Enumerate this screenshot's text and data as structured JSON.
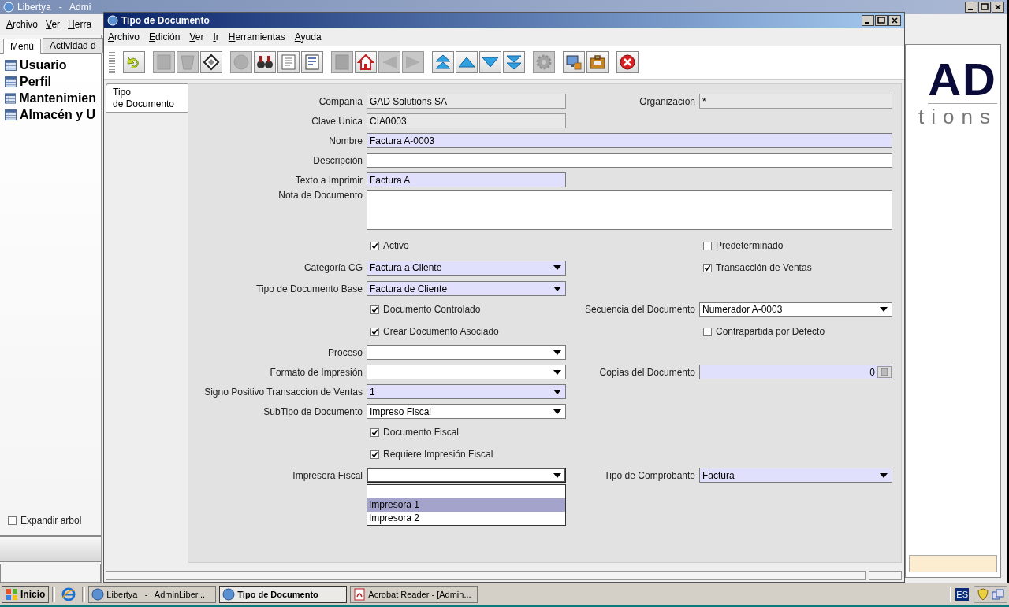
{
  "main_window": {
    "title": "Libertya   -   Admi",
    "menu": [
      "Archivo",
      "Ver",
      "Herra"
    ],
    "side_tabs": [
      {
        "label": "Menú",
        "selected": true
      },
      {
        "label": "Actividad d",
        "selected": false
      }
    ],
    "tree": [
      {
        "label": "Usuario"
      },
      {
        "label": "Perfil"
      },
      {
        "label": "Mantenimien"
      },
      {
        "label": "Almacén y U"
      }
    ],
    "expand_tree": {
      "label": "Expandir arbol",
      "checked": false
    },
    "logo": {
      "mark": "AD",
      "word": "tions"
    }
  },
  "dialog": {
    "title": "Tipo de Documento",
    "menu": [
      "Archivo",
      "Edición",
      "Ver",
      "Ir",
      "Herramientas",
      "Ayuda"
    ],
    "toolbar": [
      [
        {
          "disabled": false
        }
      ],
      [
        {
          "disabled": true
        },
        {
          "disabled": true
        },
        {
          "disabled": false
        }
      ],
      [
        {
          "disabled": true
        },
        {
          "disabled": false
        },
        {
          "disabled": false
        },
        {
          "disabled": false
        }
      ],
      [
        {
          "disabled": true
        },
        {
          "disabled": false
        },
        {
          "disabled": true
        },
        {
          "disabled": true
        }
      ],
      [
        {
          "disabled": false
        },
        {
          "disabled": false
        },
        {
          "disabled": false
        },
        {
          "disabled": false
        }
      ],
      [
        {
          "disabled": true
        }
      ],
      [
        {
          "disabled": false
        },
        {
          "disabled": false
        }
      ],
      [
        {
          "disabled": false
        }
      ]
    ],
    "tabs": [
      {
        "label": "Tipo\nde Documento",
        "selected": true
      }
    ],
    "rows": [
      {
        "left": {
          "kind": "text",
          "label": "Compañía",
          "value": "GAD Solutions SA",
          "mandatory": false,
          "readonly": true
        },
        "right": {
          "kind": "text",
          "label": "Organización",
          "value": "*",
          "mandatory": false,
          "readonly": true
        }
      },
      {
        "left": {
          "kind": "text",
          "label": "Clave Unica",
          "value": "CIA0003",
          "mandatory": false,
          "readonly": true
        }
      },
      {
        "left": {
          "kind": "wide_text",
          "label": "Nombre",
          "value": "Factura A-0003",
          "mandatory": true,
          "readonly": false
        }
      },
      {
        "left": {
          "kind": "wide_text",
          "label": "Descripción",
          "mandatory": false,
          "readonly": false
        }
      },
      {
        "left": {
          "kind": "text",
          "label": "Texto a Imprimir",
          "value": "Factura A",
          "mandatory": true,
          "readonly": false
        }
      },
      {
        "left": {
          "kind": "textarea",
          "label": "Nota de Documento",
          "mandatory": false,
          "readonly": false
        }
      },
      {
        "left": {
          "kind": "check",
          "label": "Activo",
          "checked": true
        },
        "right": {
          "kind": "check",
          "label": "Predeterminado",
          "checked": false
        }
      },
      {
        "left": {
          "kind": "combo",
          "label": "Categoría CG",
          "value": "Factura a Cliente",
          "mandatory": true,
          "open": false
        },
        "right": {
          "kind": "check",
          "label": "Transacción de Ventas",
          "checked": true
        }
      },
      {
        "left": {
          "kind": "combo",
          "label": "Tipo de Documento Base",
          "value": "Factura de Cliente",
          "mandatory": true,
          "open": false
        }
      },
      {
        "left": {
          "kind": "check",
          "label": "Documento Controlado",
          "checked": true
        },
        "right": {
          "kind": "combo",
          "label": "Secuencia del Documento",
          "value": "Numerador  A-0003",
          "mandatory": false,
          "open": false
        }
      },
      {
        "left": {
          "kind": "check",
          "label": "Crear Documento Asociado",
          "checked": true
        },
        "right": {
          "kind": "check",
          "label": "Contrapartida por Defecto",
          "checked": false
        }
      },
      {
        "left": {
          "kind": "combo",
          "label": "Proceso",
          "mandatory": false,
          "open": false
        }
      },
      {
        "left": {
          "kind": "combo",
          "label": "Formato de Impresión",
          "mandatory": false,
          "open": false
        },
        "right": {
          "kind": "number",
          "label": "Copias del Documento",
          "value": "0",
          "mandatory": true
        }
      },
      {
        "left": {
          "kind": "combo",
          "label": "Signo Positivo Transaccion de Ventas",
          "value": "1",
          "mandatory": true,
          "open": false
        }
      },
      {
        "left": {
          "kind": "combo",
          "label": "SubTipo de Documento",
          "value": "Impreso Fiscal",
          "mandatory": false,
          "open": false
        }
      },
      {
        "left": {
          "kind": "check",
          "label": "Documento Fiscal",
          "checked": true
        }
      },
      {
        "left": {
          "kind": "check",
          "label": "Requiere Impresión Fiscal",
          "checked": true
        }
      },
      {
        "left": {
          "kind": "combo",
          "label": "Impresora Fiscal",
          "mandatory": false,
          "open": true,
          "options": [
            {
              "label": "Impresora 1",
              "selected": true
            },
            {
              "label": "Impresora 2",
              "selected": false
            }
          ]
        },
        "right": {
          "kind": "combo",
          "label": "Tipo de Comprobante",
          "value": "Factura",
          "mandatory": true,
          "open": false
        }
      }
    ]
  },
  "taskbar": {
    "start": "Inicio",
    "tasks": [
      {
        "label": "Libertya   -   AdminLiber...",
        "selected": false
      },
      {
        "label": "Tipo de Documento",
        "selected": true
      },
      {
        "label": "Acrobat Reader - [Admin...",
        "selected": false
      }
    ],
    "language": "ES"
  }
}
